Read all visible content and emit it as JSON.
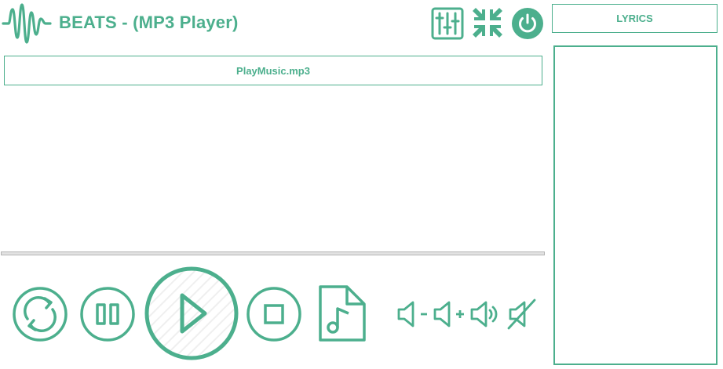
{
  "app": {
    "title": "BEATS - (MP3 Player)",
    "accent_color": "#4caf8d",
    "logo_icon": "soundwave-icon"
  },
  "header": {
    "buttons": [
      {
        "name": "equalizer-button",
        "icon": "equalizer-sliders-icon"
      },
      {
        "name": "minimize-button",
        "icon": "compress-arrows-icon"
      },
      {
        "name": "power-button",
        "icon": "power-icon"
      }
    ]
  },
  "lyrics": {
    "button_label": "LYRICS",
    "text": ""
  },
  "player": {
    "file_name": "PlayMusic.mp3",
    "progress": 0.0
  },
  "controls": {
    "transport": [
      "repeat-icon",
      "pause-icon",
      "play-icon",
      "stop-icon",
      "music-file-icon"
    ],
    "volume": [
      "volume-down-icon",
      "volume-up-icon",
      "volume-max-icon",
      "mute-icon"
    ]
  }
}
